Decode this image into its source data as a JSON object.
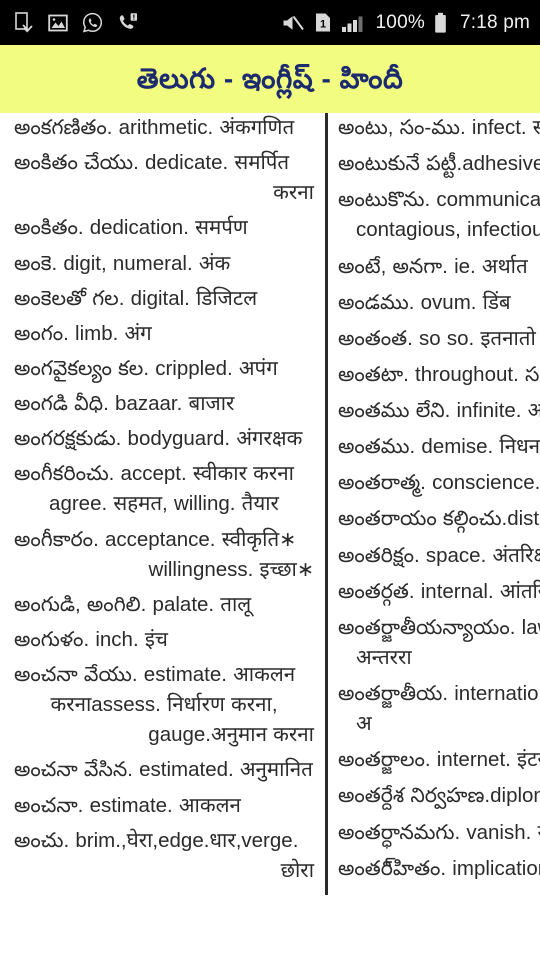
{
  "status_bar": {
    "left_icons": [
      {
        "name": "download-complete-icon",
        "glyph": "download-doc"
      },
      {
        "name": "gallery-image-icon",
        "glyph": "image"
      },
      {
        "name": "whatsapp-icon",
        "glyph": "whatsapp"
      },
      {
        "name": "missed-call-icon",
        "glyph": "missed-call"
      }
    ],
    "right_icons": [
      {
        "name": "mute-icon",
        "glyph": "speaker-mute"
      },
      {
        "name": "sim-card-1-icon",
        "glyph": "sim-1",
        "label": "1"
      },
      {
        "name": "signal-strength-icon",
        "glyph": "signal-bars"
      }
    ],
    "battery_percent": "100%",
    "battery_icon": "battery-full-icon",
    "clock": "7:18 pm",
    "background_color": "#000000",
    "text_color": "#f0f0f0"
  },
  "header": {
    "title": "తెలుగు - ఇంగ్లీష్ - హిందీ",
    "background_color": "#f2fc80",
    "text_color": "#1c2a6e"
  },
  "dictionary": {
    "left_column": [
      {
        "line1": "అంకగణితం. arithmetic. अंकगणित"
      },
      {
        "line1": "అంకితం చేయు. dedicate. समर्पित",
        "cont": "करना"
      },
      {
        "line1": "అంకితం. dedication. समर्पण"
      },
      {
        "line1": "అంకె. digit, numeral. अंक"
      },
      {
        "line1": "అంకెలతో గల. digital. डिजिटल"
      },
      {
        "line1": "అంగం. limb. अंग"
      },
      {
        "line1": "అంగవైకల్యం కల. crippled. अपंग"
      },
      {
        "line1": "అంగడి వీధి. bazaar. बाजार"
      },
      {
        "line1": "అంగరక్షకుడు. bodyguard. अंगरक्षक"
      },
      {
        "line1": "అంగీకరించు. accept. स्वीकार करना",
        "cont_ind": "agree. सहमत, willing. तैयार"
      },
      {
        "line1": "అంగీకారం. acceptance. स्वीकृति∗",
        "cont": "willingness. इच्छा∗"
      },
      {
        "line1": "అంగుడి, అంగిలి. palate. तालू"
      },
      {
        "line1": "అంగుళం. inch. इंच"
      },
      {
        "line1": "అంచనా వేయు. estimate. आकलन",
        "cont_ind": "करनाassess. निर्धारण करना,",
        "cont2": "gauge.अनुमान करना"
      },
      {
        "line1": "అంచనా వేసిన. estimated. अनुमानित"
      },
      {
        "line1": "అంచనా. estimate. आकलन"
      },
      {
        "line1": "అంచు. brim.,घेरा,edge.धार,verge.",
        "cont": "छोरा"
      }
    ],
    "right_column": [
      {
        "line1": "అంటు, సం-ము. infect. संक्राम",
        "clipped_top": true
      },
      {
        "line1": "అంటుకునే పట్టీ.adhesive ta"
      },
      {
        "line1": "అంటుకొను. communicabl",
        "cont_ind": "contagious, infectiou"
      },
      {
        "line1": "అంటే, అనగా. ie. अर्थात"
      },
      {
        "line1": "అండము. ovum. डिंब"
      },
      {
        "line1": "అంతంత. so so. इतनातो"
      },
      {
        "line1": "అంతటా. throughout. సర్వ"
      },
      {
        "line1": "అంతము లేని. infinite. अनंं"
      },
      {
        "line1": "అంతము. demise. निधन"
      },
      {
        "line1": "అంతరాత్మ. conscience. अं"
      },
      {
        "line1": "అంతరాయం కల్గించు.disturb"
      },
      {
        "line1": "అంతరిక్షం. space. अंतरिक्ष"
      },
      {
        "line1": "అంతర్గత. internal. आंतरिक"
      },
      {
        "line1": "అంతర్జాతీయన్యాయం. law of",
        "cont_ind": "अन्तररा"
      },
      {
        "line1": "అంతర్జాతీయ. internationa",
        "cont_ind": "अ"
      },
      {
        "line1": "అంతర్జాలం. internet. इंटरन"
      },
      {
        "line1": "అంతర్దేశ నిర్వహణ.diploma"
      },
      {
        "line1": "అంతర్ధానమగు. vanish. गाय"
      },
      {
        "line1": "అంతరి్హితం. implication"
      }
    ]
  }
}
